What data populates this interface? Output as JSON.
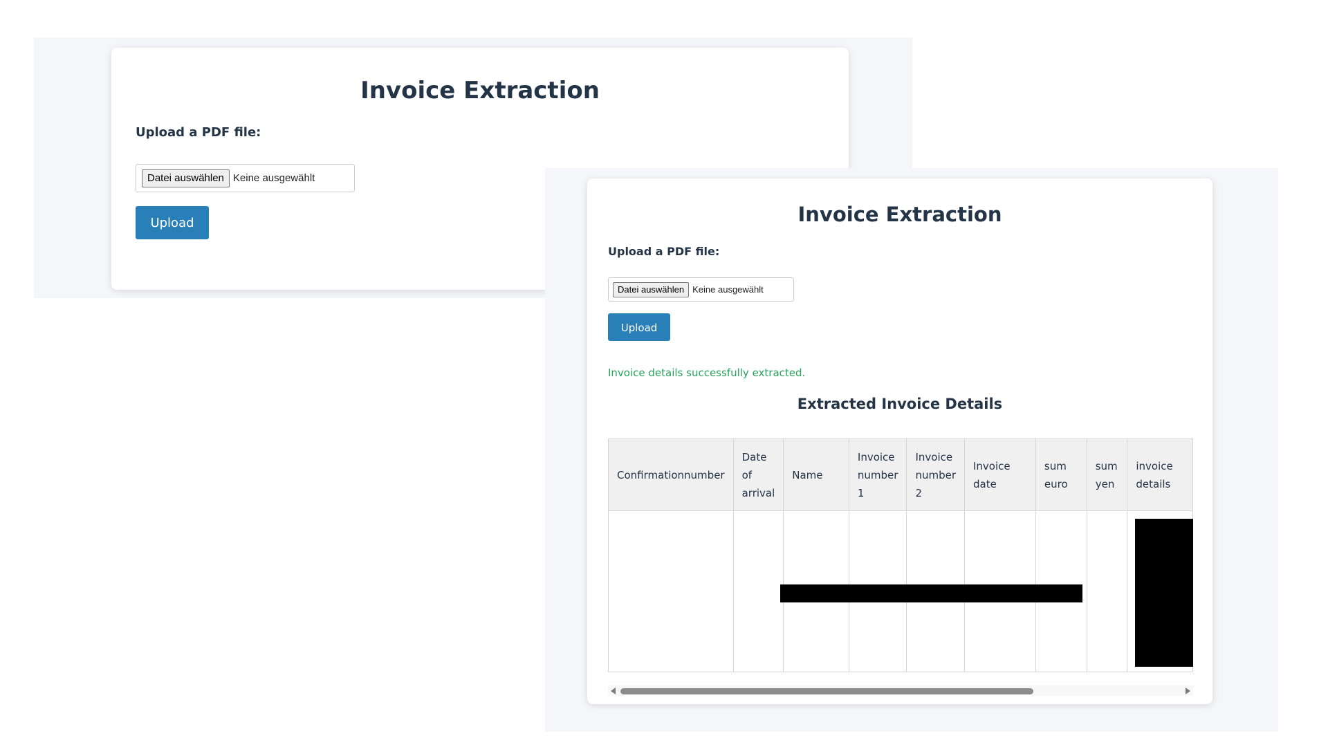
{
  "screen_1": {
    "title": "Invoice Extraction",
    "upload_label": "Upload a PDF file:",
    "file_button_label": "Datei auswählen",
    "file_status": "Keine ausgewählt",
    "upload_button_label": "Upload"
  },
  "screen_2": {
    "title": "Invoice Extraction",
    "upload_label": "Upload a PDF file:",
    "file_button_label": "Datei auswählen",
    "file_status": "Keine ausgewählt",
    "upload_button_label": "Upload",
    "success_message": "Invoice details successfully extracted.",
    "section_title": "Extracted Invoice Details",
    "table": {
      "columns": [
        "Confirmationnumber",
        "Date of arrival",
        "Name",
        "Invoice number 1",
        "Invoice number 2",
        "Invoice date",
        "sum euro",
        "sum yen",
        "invoice details"
      ]
    }
  },
  "colors": {
    "accent": "#2980b9",
    "success": "#27a35a",
    "heading": "#243447",
    "panel_background": "#f4f6f9"
  },
  "icons": {
    "scroll_left": "triangle-left-icon",
    "scroll_right": "triangle-right-icon"
  }
}
